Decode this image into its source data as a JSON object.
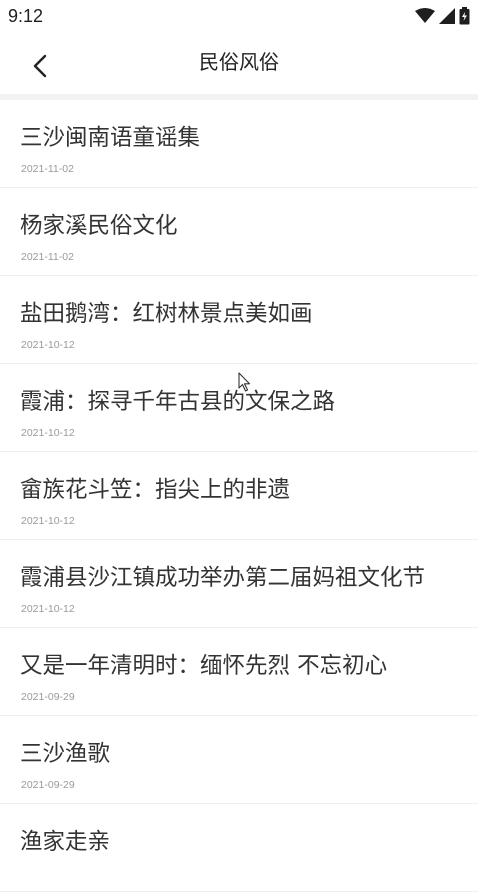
{
  "status_bar": {
    "time": "9:12",
    "icons": [
      "wifi-icon",
      "signal-icon",
      "battery-icon"
    ]
  },
  "header": {
    "title": "民俗风俗",
    "back_icon": "chevron-left-icon"
  },
  "articles": [
    {
      "title": "三沙闽南语童谣集",
      "date": "2021-11-02"
    },
    {
      "title": "杨家溪民俗文化",
      "date": "2021-11-02"
    },
    {
      "title": "盐田鹅湾：红树林景点美如画",
      "date": "2021-10-12"
    },
    {
      "title": "霞浦：探寻千年古县的文保之路",
      "date": "2021-10-12"
    },
    {
      "title": "畲族花斗笠：指尖上的非遗",
      "date": "2021-10-12"
    },
    {
      "title": "霞浦县沙江镇成功举办第二届妈祖文化节",
      "date": "2021-10-12"
    },
    {
      "title": "又是一年清明时：缅怀先烈 不忘初心",
      "date": "2021-09-29"
    },
    {
      "title": "三沙渔歌",
      "date": "2021-09-29"
    },
    {
      "title": "渔家走亲",
      "date": ""
    }
  ],
  "colors": {
    "text": "#333333",
    "date": "#9a9a9a",
    "divider": "#efefef",
    "header_shadow": "#f2f2f2"
  }
}
